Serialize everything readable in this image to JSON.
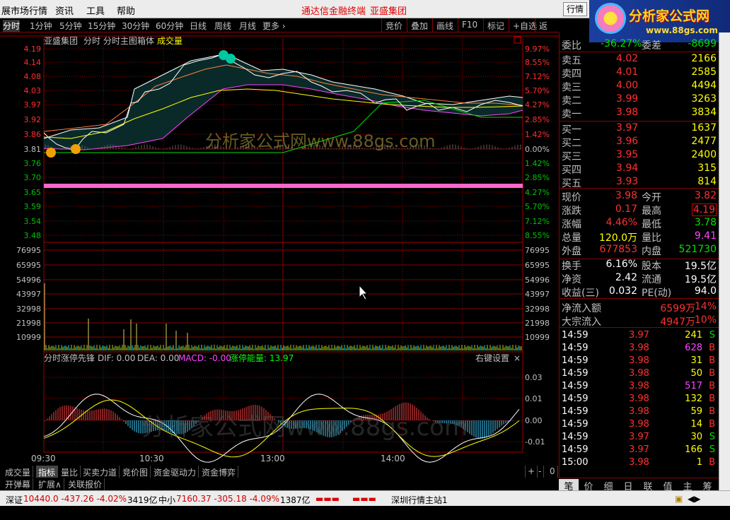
{
  "menu": {
    "left": "展市场行情",
    "items": [
      "资讯",
      "工具",
      "帮助"
    ],
    "title1": "通达信金融终端",
    "title2": "亚盛集团",
    "market_btn": "行情"
  },
  "logo": {
    "title": "分析家公式网",
    "url": "www.88gs.com"
  },
  "toolbar": {
    "periods": [
      "分时",
      "1分钟",
      "5分钟",
      "15分钟",
      "30分钟",
      "60分钟",
      "日线",
      "周线",
      "月线",
      "更多 ›"
    ],
    "right": [
      "竞价",
      "叠加",
      "画线",
      "F10",
      "标记",
      "+自选",
      "返回"
    ]
  },
  "chart": {
    "header": {
      "name": "亚盛集团",
      "mode": "分时",
      "indicator": "分时主图箱体",
      "vol": "成交量"
    },
    "price_left": [
      "4.19",
      "4.14",
      "4.08",
      "4.03",
      "3.97",
      "3.92",
      "3.86",
      "3.81",
      "3.76",
      "3.70",
      "3.65",
      "3.59",
      "3.54",
      "3.48"
    ],
    "pct_right": [
      "9.97%",
      "8.55%",
      "7.12%",
      "5.70%",
      "4.27%",
      "2.85%",
      "1.42%",
      "0.00%",
      "1.42%",
      "2.85%",
      "4.27%",
      "5.70%",
      "7.12%",
      "8.55%"
    ],
    "vol_left": [
      "76995",
      "65995",
      "54996",
      "43997",
      "32998",
      "21998",
      "10999"
    ],
    "vol_right": [
      "76995",
      "65995",
      "54996",
      "43997",
      "32998",
      "21998",
      "10999"
    ],
    "macd_header": {
      "name": "分时涨停先锋",
      "dif": "DIF: 0.00",
      "dea": "DEA: 0.00",
      "macd": "MACD: -0.00",
      "zt": "涨停能量: 13.97",
      "settings": "右键设置",
      "close": "×"
    },
    "macd_right": [
      "0.03",
      "0.01",
      "0.00",
      "-0.01"
    ],
    "time_labels": [
      "09:30",
      "10:30",
      "13:00",
      "14:00"
    ],
    "watermark": "分析家公式网www.88gs.com",
    "colors": {
      "grid": "#8a0000",
      "price": "#ffffff",
      "avg": "#ffff00",
      "up": "#ff3030",
      "down": "#00e0e0",
      "magenta": "#ff44ff",
      "green": "#00ff00",
      "pink": "#ff66cc"
    }
  },
  "bottom_tabs": [
    "成交量",
    "指标",
    "量比",
    "买卖力道",
    "竞价图",
    "资金驱动力",
    "资金博弈"
  ],
  "bottom_tabs2": [
    "开弹幕",
    "扩展∧",
    "关联报价"
  ],
  "bottom_ctrl": [
    "+",
    "-",
    "0"
  ],
  "status": {
    "sz_label": "深证",
    "sz": "10440.0 -437.26 -4.02%",
    "sz_amt": "3419亿",
    "zx_label": "中小",
    "zx": "7160.37 -305.18 -4.09%",
    "zx_amt": "1387亿",
    "site": "深圳行情主站1"
  },
  "quote": {
    "wb_label": "委比",
    "wb": "-36.27%",
    "wc_label": "委差",
    "wc": "-8699",
    "sell": [
      {
        "l": "卖五",
        "p": "4.02",
        "v": "2166"
      },
      {
        "l": "卖四",
        "p": "4.01",
        "v": "2585"
      },
      {
        "l": "卖三",
        "p": "4.00",
        "v": "4494"
      },
      {
        "l": "卖二",
        "p": "3.99",
        "v": "3263"
      },
      {
        "l": "卖一",
        "p": "3.98",
        "v": "3834"
      }
    ],
    "buy": [
      {
        "l": "买一",
        "p": "3.97",
        "v": "1637"
      },
      {
        "l": "买二",
        "p": "3.96",
        "v": "2477"
      },
      {
        "l": "买三",
        "p": "3.95",
        "v": "2400"
      },
      {
        "l": "买四",
        "p": "3.94",
        "v": "315"
      },
      {
        "l": "买五",
        "p": "3.93",
        "v": "814"
      }
    ],
    "stats": [
      {
        "l1": "现价",
        "v1": "3.98",
        "l2": "今开",
        "v2": "3.82"
      },
      {
        "l1": "涨跌",
        "v1": "0.17",
        "l2": "最高",
        "v2": "4.19"
      },
      {
        "l1": "涨幅",
        "v1": "4.46%",
        "l2": "最低",
        "v2": "3.78"
      },
      {
        "l1": "总量",
        "v1": "120.0万",
        "l2": "量比",
        "v2": "9.41"
      },
      {
        "l1": "外盘",
        "v1": "677853",
        "l2": "内盘",
        "v2": "521730"
      }
    ],
    "stats2": [
      {
        "l1": "换手",
        "v1": "6.16%",
        "l2": "股本",
        "v2": "19.5亿"
      },
      {
        "l1": "净资",
        "v1": "2.42",
        "l2": "流通",
        "v2": "19.5亿"
      },
      {
        "l1": "收益(三)",
        "v1": "0.032",
        "l2": "PE(动)",
        "v2": "94.0"
      }
    ],
    "flow": [
      {
        "l": "净流入额",
        "v": "6599万",
        "p": "14%"
      },
      {
        "l": "大宗流入",
        "v": "4947万",
        "p": "10%"
      }
    ],
    "ticks": [
      {
        "t": "14:59",
        "p": "3.97",
        "v": "241",
        "s": "S"
      },
      {
        "t": "14:59",
        "p": "3.98",
        "v": "628",
        "s": "B"
      },
      {
        "t": "14:59",
        "p": "3.98",
        "v": "31",
        "s": "B"
      },
      {
        "t": "14:59",
        "p": "3.98",
        "v": "50",
        "s": "B"
      },
      {
        "t": "14:59",
        "p": "3.98",
        "v": "517",
        "s": "B"
      },
      {
        "t": "14:59",
        "p": "3.98",
        "v": "132",
        "s": "B"
      },
      {
        "t": "14:59",
        "p": "3.98",
        "v": "59",
        "s": "B"
      },
      {
        "t": "14:59",
        "p": "3.98",
        "v": "14",
        "s": "B"
      },
      {
        "t": "14:59",
        "p": "3.97",
        "v": "30",
        "s": "S"
      },
      {
        "t": "14:59",
        "p": "3.97",
        "v": "166",
        "s": "S"
      },
      {
        "t": "15:00",
        "p": "3.98",
        "v": "1",
        "s": "B"
      }
    ],
    "tabs": [
      "笔",
      "价",
      "细",
      "日",
      "联",
      "值",
      "主",
      "筹"
    ]
  }
}
